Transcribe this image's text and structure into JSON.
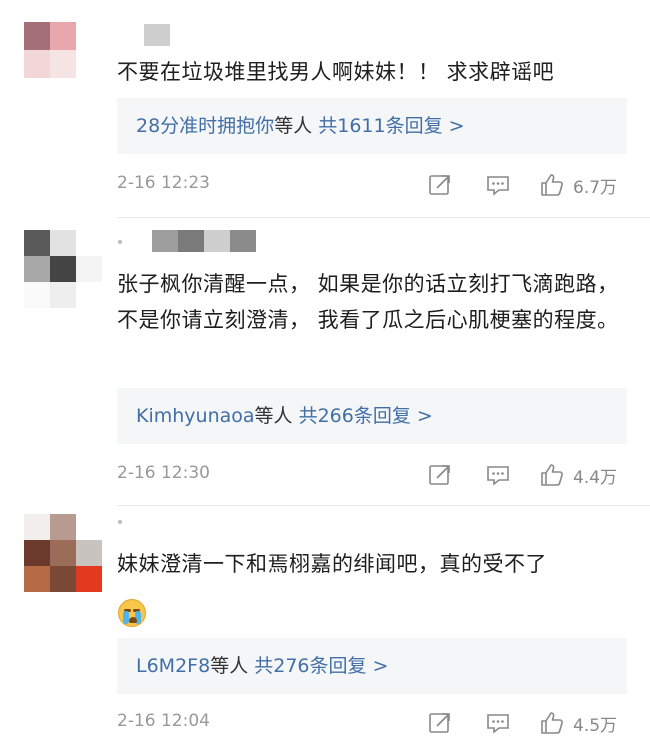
{
  "comments": [
    {
      "text": "不要在垃圾堆里找男人啊妹妹！！ 求求辟谣吧",
      "reply_preview": {
        "user": "28分准时拥抱你",
        "mid": "等人",
        "total": "共1611条回复 >"
      },
      "time": "2-16 12:23",
      "likes": "6.7万"
    },
    {
      "text": "张子枫你清醒一点， 如果是你的话立刻打飞滴跑路， 不是你请立刻澄清， 我看了瓜之后心肌梗塞的程度。",
      "reply_preview": {
        "user": "Kimhyunaoa",
        "mid": "等人",
        "total": "共266条回复 >"
      },
      "time": "2-16 12:30",
      "likes": "4.4万"
    },
    {
      "text": "妹妹澄清一下和焉栩嘉的绯闻吧，真的受不了",
      "emoji": "crying-face-emoji",
      "reply_preview": {
        "user": "L6M2F8",
        "mid": "等人",
        "total": "共276条回复 >"
      },
      "time": "2-16 12:04",
      "likes": "4.5万"
    }
  ],
  "icons": {
    "share": "share-icon",
    "reply": "comment-icon",
    "like": "thumbs-up-icon"
  },
  "colors": {
    "link": "#416fa6",
    "meta": "#999999",
    "reply_bg": "#f5f6f8"
  }
}
